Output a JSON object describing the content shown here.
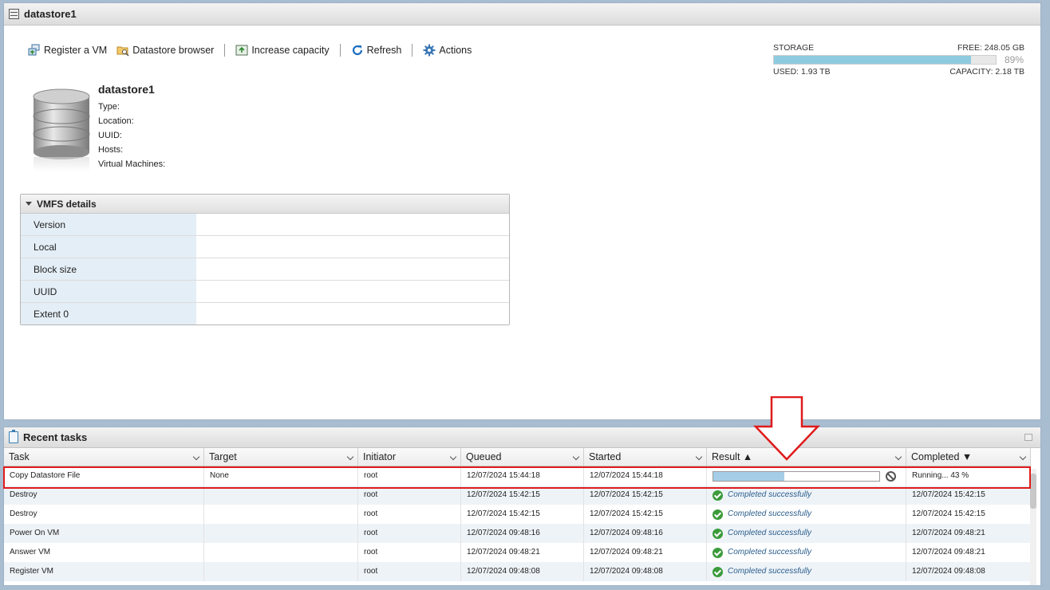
{
  "panel": {
    "title": "datastore1"
  },
  "toolbar": {
    "register_vm": "Register a VM",
    "datastore_browser": "Datastore browser",
    "increase_capacity": "Increase capacity",
    "refresh": "Refresh",
    "actions": "Actions"
  },
  "datastore": {
    "name": "datastore1",
    "fields": [
      "Type:",
      "Location:",
      "UUID:",
      "Hosts:",
      "Virtual Machines:"
    ]
  },
  "storage": {
    "label": "STORAGE",
    "free": "FREE: 248.05 GB",
    "percent": "89%",
    "percent_value": 0.89,
    "used": "USED: 1.93 TB",
    "capacity": "CAPACITY: 2.18 TB",
    "bar_color": "#8ecae0"
  },
  "vmfs": {
    "title": "VMFS details",
    "rows": [
      "Version",
      "Local",
      "Block size",
      "UUID",
      "Extent 0"
    ]
  },
  "tasks": {
    "title": "Recent tasks",
    "columns": [
      "Task",
      "Target",
      "Initiator",
      "Queued",
      "Started",
      "Result ▲",
      "Completed ▼"
    ],
    "rows": [
      {
        "task": "Copy Datastore File",
        "target": "None",
        "initiator": "root",
        "queued": "12/07/2024 15:44:18",
        "started": "12/07/2024 15:44:18",
        "result": "",
        "progress": 0.43,
        "completed": "Running... 43 %"
      },
      {
        "task": "Destroy",
        "target": "",
        "initiator": "root",
        "queued": "12/07/2024 15:42:15",
        "started": "12/07/2024 15:42:15",
        "result": "Completed successfully",
        "completed": "12/07/2024 15:42:15"
      },
      {
        "task": "Destroy",
        "target": "",
        "initiator": "root",
        "queued": "12/07/2024 15:42:15",
        "started": "12/07/2024 15:42:15",
        "result": "Completed successfully",
        "completed": "12/07/2024 15:42:15"
      },
      {
        "task": "Power On VM",
        "target": "",
        "initiator": "root",
        "queued": "12/07/2024 09:48:16",
        "started": "12/07/2024 09:48:16",
        "result": "Completed successfully",
        "completed": "12/07/2024 09:48:21"
      },
      {
        "task": "Answer VM",
        "target": "",
        "initiator": "root",
        "queued": "12/07/2024 09:48:21",
        "started": "12/07/2024 09:48:21",
        "result": "Completed successfully",
        "completed": "12/07/2024 09:48:21"
      },
      {
        "task": "Register VM",
        "target": "",
        "initiator": "root",
        "queued": "12/07/2024 09:48:08",
        "started": "12/07/2024 09:48:08",
        "result": "Completed successfully",
        "completed": "12/07/2024 09:48:08"
      }
    ]
  },
  "annotation": {
    "color": "#e01b1b"
  }
}
